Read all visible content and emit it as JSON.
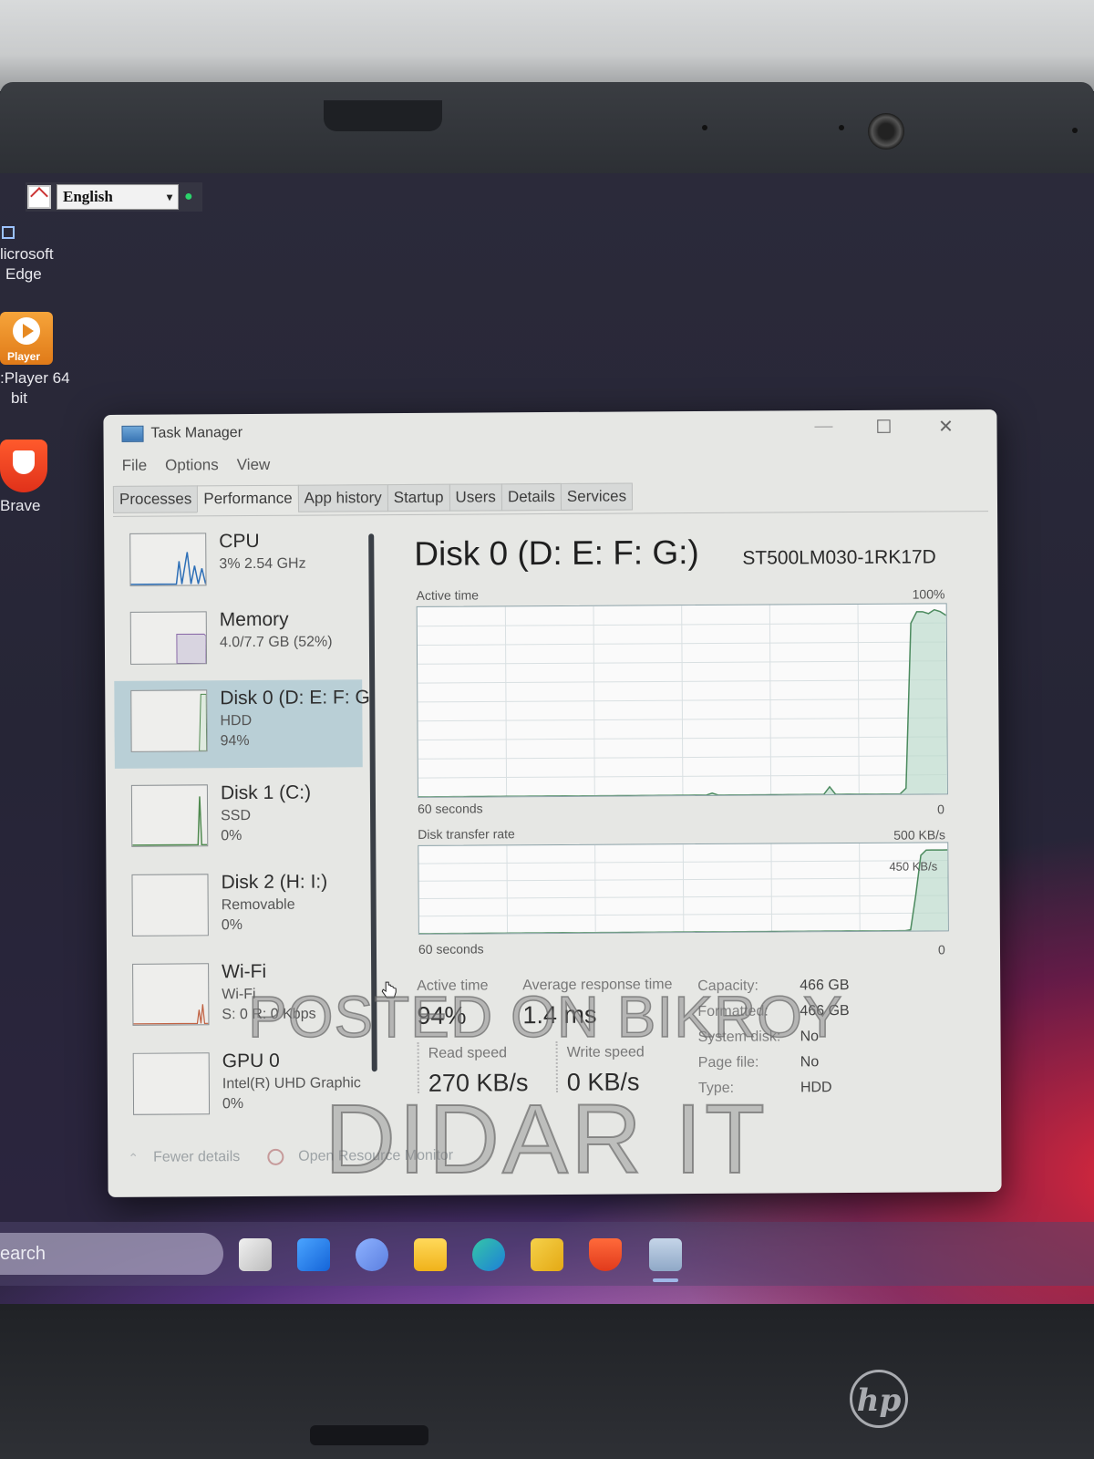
{
  "desktop": {
    "language": {
      "selected": "English"
    },
    "icons": [
      {
        "label_line1": "licrosoft",
        "label_line2": "Edge"
      },
      {
        "glyph_text": "Player",
        "label_line1": ":Player 64",
        "label_line2": "bit"
      },
      {
        "label_line1": "Brave",
        "label_line2": ""
      }
    ]
  },
  "window": {
    "title": "Task Manager",
    "controls": {
      "minimize": "—",
      "maximize": "☐",
      "close": "✕"
    },
    "menu": [
      "File",
      "Options",
      "View"
    ],
    "tabs": [
      "Processes",
      "Performance",
      "App history",
      "Startup",
      "Users",
      "Details",
      "Services"
    ],
    "active_tab": "Performance"
  },
  "sidebar": [
    {
      "name": "CPU",
      "line2": "3%  2.54 GHz",
      "line3": ""
    },
    {
      "name": "Memory",
      "line2": "4.0/7.7 GB (52%)",
      "line3": ""
    },
    {
      "name": "Disk 0 (D: E: F: G",
      "line2": "HDD",
      "line3": "94%",
      "selected": true
    },
    {
      "name": "Disk 1 (C:)",
      "line2": "SSD",
      "line3": "0%"
    },
    {
      "name": "Disk 2 (H: I:)",
      "line2": "Removable",
      "line3": "0%"
    },
    {
      "name": "Wi-Fi",
      "line2": "Wi-Fi",
      "line3": "S: 0  R: 0 Kbps"
    },
    {
      "name": "GPU 0",
      "line2": "Intel(R) UHD Graphic",
      "line3": "0%"
    }
  ],
  "detail": {
    "title": "Disk 0 (D: E: F: G:)",
    "model": "ST500LM030-1RK17D",
    "active_graph": {
      "label": "Active time",
      "max_label": "100%",
      "time_label": "60 seconds",
      "min_label": "0",
      "values_pct": [
        0,
        0,
        0,
        0,
        0,
        0,
        0,
        0,
        0,
        0,
        0,
        0,
        0,
        0,
        0,
        0,
        0,
        0,
        0,
        0,
        0,
        0,
        0,
        0,
        0,
        0,
        0,
        0,
        0,
        0,
        0,
        0,
        0,
        0,
        0,
        0,
        0,
        0,
        0,
        0,
        0,
        0,
        0,
        0,
        0,
        0,
        0,
        0,
        0,
        0,
        1,
        0,
        0,
        0,
        0,
        0,
        0,
        0,
        0,
        0,
        0,
        0,
        0,
        0,
        0,
        0,
        0,
        0,
        0,
        0,
        4,
        0,
        0,
        0,
        0,
        0,
        0,
        0,
        0,
        0,
        0,
        0,
        0,
        3,
        90,
        96,
        96,
        95,
        97,
        96,
        94
      ]
    },
    "transfer_graph": {
      "label": "Disk transfer rate",
      "max_label": "500 KB/s",
      "inner_label": "450 KB/s",
      "time_label": "60 seconds",
      "min_label": "0",
      "values_kbs": [
        0,
        0,
        0,
        0,
        0,
        0,
        0,
        0,
        0,
        0,
        0,
        0,
        0,
        0,
        0,
        0,
        0,
        0,
        0,
        0,
        0,
        0,
        0,
        0,
        0,
        0,
        0,
        0,
        0,
        0,
        0,
        0,
        0,
        0,
        0,
        0,
        0,
        0,
        0,
        0,
        0,
        0,
        0,
        0,
        0,
        0,
        0,
        0,
        0,
        0,
        0,
        0,
        0,
        0,
        0,
        0,
        0,
        0,
        0,
        0,
        0,
        0,
        0,
        0,
        0,
        0,
        0,
        0,
        0,
        0,
        0,
        0,
        0,
        0,
        0,
        0,
        0,
        0,
        0,
        0,
        0,
        0,
        0,
        0,
        0,
        0,
        0,
        0,
        0,
        0,
        0,
        0,
        5,
        200,
        430,
        460,
        460,
        460,
        460,
        460
      ]
    },
    "stats": {
      "active_time": {
        "label": "Active time",
        "value": "94%"
      },
      "avg_response": {
        "label": "Average response time",
        "value": "1.4 ms"
      },
      "read_speed": {
        "label": "Read speed",
        "value": "270 KB/s"
      },
      "write_speed": {
        "label": "Write speed",
        "value": "0 KB/s"
      }
    },
    "properties": [
      {
        "label": "Capacity:",
        "value": "466 GB"
      },
      {
        "label": "Formatted:",
        "value": "466 GB"
      },
      {
        "label": "System disk:",
        "value": "No"
      },
      {
        "label": "Page file:",
        "value": "No"
      },
      {
        "label": "Type:",
        "value": "HDD"
      }
    ]
  },
  "footer": {
    "fewer_details": "Fewer details",
    "open_resource_monitor": "Open Resource Monitor"
  },
  "watermark": {
    "line1": "POSTED ON BIKROY",
    "line2": "DIDAR IT"
  },
  "taskbar": {
    "search_text": "earch",
    "icons": [
      "task-view-icon",
      "start-icon",
      "chat-icon",
      "file-explorer-icon",
      "edge-icon",
      "store-icon",
      "brave-icon",
      "task-manager-icon"
    ]
  }
}
